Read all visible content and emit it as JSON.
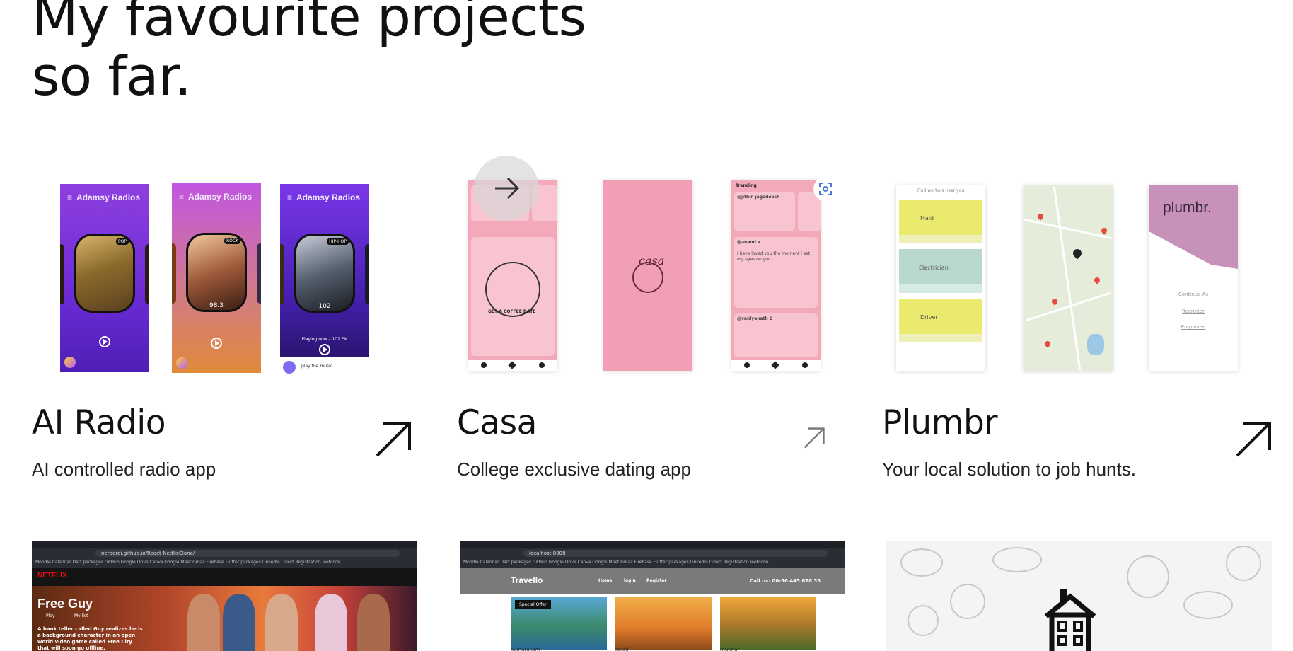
{
  "heading": {
    "line1": "My favourite projects",
    "line2": "so far."
  },
  "projects": [
    {
      "title": "AI Radio",
      "description": "AI controlled radio app",
      "screens": {
        "app_title": "Adamsy Radios",
        "menu_glyph": "≡",
        "genres": [
          "POP",
          "ROCK",
          "HIP-HOP"
        ],
        "frequencies": [
          "98.3",
          "102"
        ],
        "now_playing": "Playing now – 102 FM",
        "prompt": "play the music"
      }
    },
    {
      "title": "Casa",
      "description": "College exclusive dating app",
      "screens": {
        "tab": "Trending",
        "users": [
          "@jithin jagadeesh",
          "@anand v",
          "@vaidyanath B"
        ],
        "splash_logo": "casa",
        "coffee_date": "GET A COFFEE DATE",
        "post_text": "i have loved you the moment i set my eyes on you"
      }
    },
    {
      "title": "Plumbr",
      "description": "Your local solution to job hunts.",
      "screens": {
        "search_hint": "Find workers near you",
        "jobs": [
          "Maid",
          "Electrician",
          "Driver"
        ],
        "logo": "plumbr.",
        "continue_as": "Continue As",
        "roles": [
          "Recruiter",
          "Employee"
        ]
      }
    }
  ],
  "previews": {
    "netflix": {
      "url": "nerberdi.github.io/React-NetflixClone/",
      "brand": "NETFLIX",
      "movie": "Free Guy",
      "buttons": [
        "Play",
        "My list"
      ],
      "blurb": "A bank teller called Guy realizes he is a background character in an open world video game called Free City that will soon go offline."
    },
    "travello": {
      "url": "localhost:8000",
      "brand": "Travello",
      "nav": [
        "Home",
        "login",
        "Register"
      ],
      "phone": "Call us: 00-56 445 678 33",
      "badge": "Special Offer",
      "places": [
        "kumarakom",
        "kochi",
        "munnar"
      ]
    }
  },
  "bookmarks": "Moodle   Calendar   Dart packages   GitHub   Google Drive   Canva   Google Meet   Gmail   Firebase   Flutter packages   LinkedIn   Direct Registration   leetcode"
}
